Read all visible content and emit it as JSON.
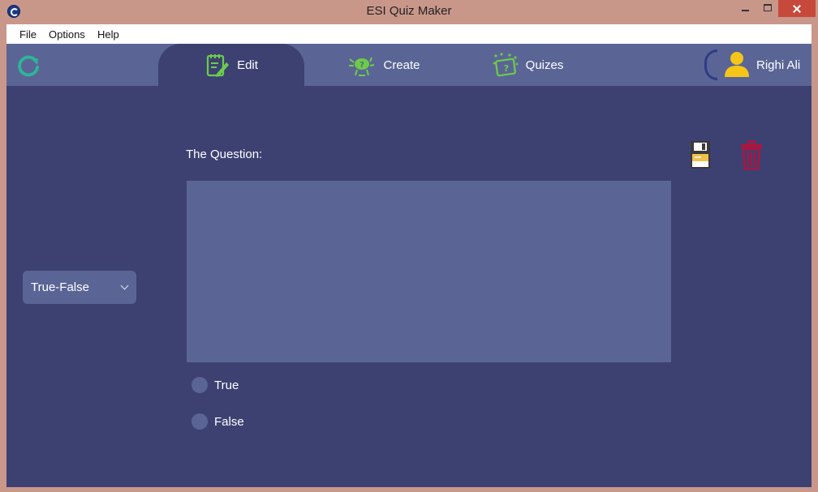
{
  "window": {
    "title": "ESI Quiz Maker"
  },
  "menu": {
    "items": [
      "File",
      "Options",
      "Help"
    ]
  },
  "nav": {
    "tabs": [
      {
        "label": "Edit",
        "icon": "edit-notepad-icon",
        "active": true
      },
      {
        "label": "Create",
        "icon": "create-icon",
        "active": false
      },
      {
        "label": "Quizes",
        "icon": "quizes-icon",
        "active": false
      }
    ],
    "user_name": "Righi Ali"
  },
  "editor": {
    "question_type": "True-False",
    "question_label": "The Question:",
    "question_text": "",
    "options": [
      "True",
      "False"
    ]
  },
  "colors": {
    "background": "#3d4172",
    "panel": "#5a6595",
    "accent_green": "#6ccc4a",
    "refresh_teal": "#2fb39a",
    "delete_red": "#b3123c",
    "user_yellow": "#f5c518"
  }
}
